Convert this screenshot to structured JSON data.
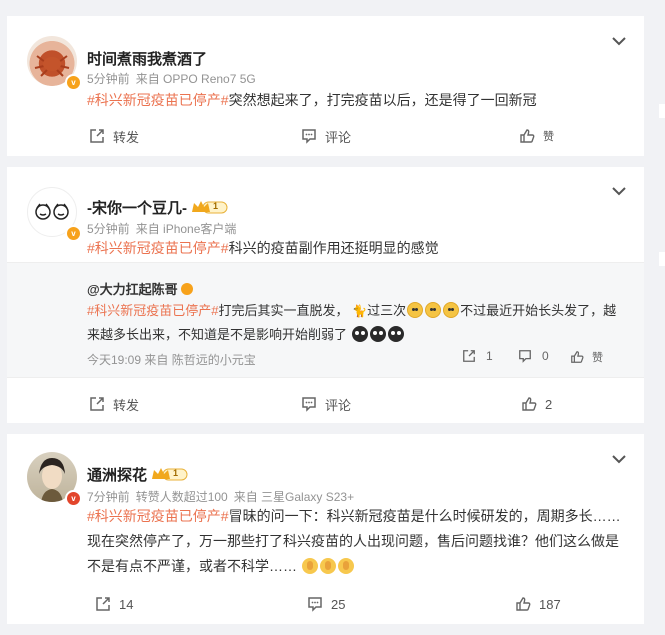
{
  "posts": [
    {
      "username": "时间煮雨我煮酒了",
      "time": "5分钟前",
      "source": "来自 OPPO Reno7 5G",
      "topic": "#科兴新冠疫苗已停产#",
      "text": "突然想起来了，打完疫苗以后，还是得了一回新冠",
      "actions": {
        "repost": "转发",
        "comment": "评论",
        "like": "赞"
      }
    },
    {
      "username": "-宋你一个豆几-",
      "level": "1",
      "time": "5分钟前",
      "source": "来自 iPhone客户端",
      "topic": "#科兴新冠疫苗已停产#",
      "text": "科兴的疫苗副作用还挺明显的感觉",
      "repost": {
        "author": "@大力扛起陈哥",
        "topic": "#科兴新冠疫苗已停产#",
        "text_a": "打完后其实一直脱发，",
        "text_b": "过三次",
        "text_c": "不过最近开始长头发了，越来越多长出来，不知道是不是影响开始削弱了",
        "meta": "今天19:09 来自 陈哲远的小元宝",
        "repost_count": "1",
        "comment_count": "0",
        "like_label": "赞"
      },
      "actions": {
        "repost": "转发",
        "comment": "评论",
        "like": "2"
      }
    },
    {
      "username": "通洲探花",
      "level": "1",
      "time": "7分钟前",
      "liked_note": "转赞人数超过100",
      "source": "来自 三星Galaxy S23+",
      "topic": "#科兴新冠疫苗已停产#",
      "text": "冒昧的问一下：科兴新冠疫苗是什么时候研发的，周期多长……现在突然停产了，万一那些打了科兴疫苗的人出现问题，售后问题找谁？他们这么做是不是有点不严谨，或者不科学……",
      "actions": {
        "repost": "14",
        "comment": "25",
        "like": "187"
      }
    }
  ],
  "colors": {
    "topic": "#eb7350",
    "vip": "#f7a21b",
    "background": "#f1f2f5"
  },
  "icons": [
    "chevron-down-icon",
    "repost-icon",
    "comment-icon",
    "like-icon",
    "verified-badge-icon",
    "crown-level-icon"
  ]
}
